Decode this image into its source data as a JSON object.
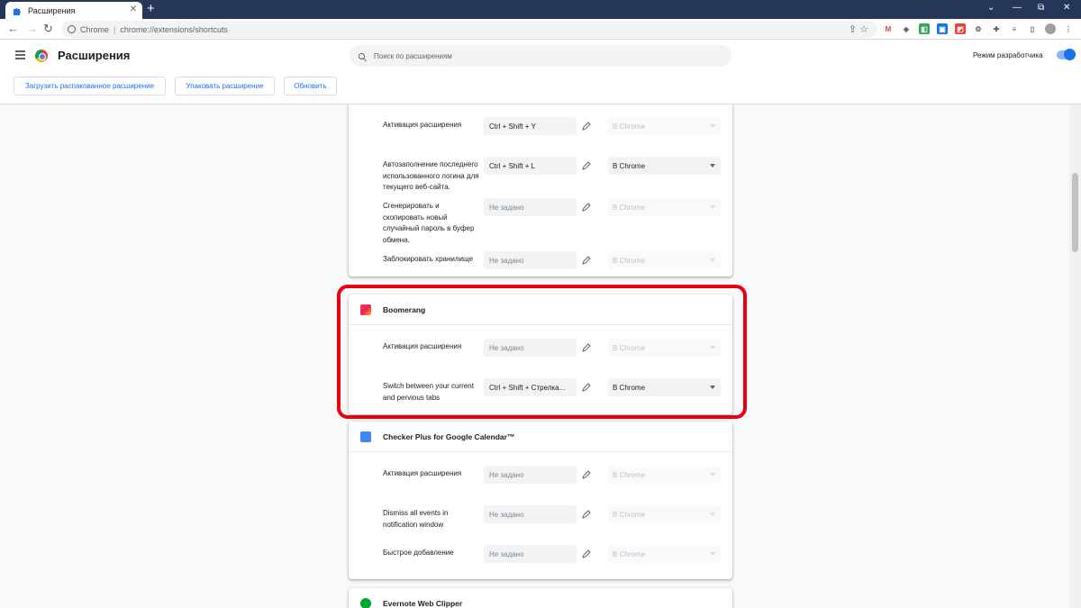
{
  "browser": {
    "tab_title": "Расширения",
    "tab_close": "✕",
    "new_tab": "+",
    "controls": {
      "dropdown": "⌄",
      "minimize": "—",
      "restore": "⧉",
      "close": "✕"
    },
    "address": {
      "site_label": "Chrome",
      "url": "chrome://extensions/shortcuts"
    }
  },
  "header": {
    "title": "Расширения",
    "search_placeholder": "Поиск по расширениям",
    "dev_mode_label": "Режим разработчика",
    "buttons": {
      "load_unpacked": "Загрузить распакованное расширение",
      "pack": "Упаковать расширение",
      "update": "Обновить"
    }
  },
  "cards": {
    "first": {
      "rows": [
        {
          "label": "Активация расширения",
          "key": "Ctrl  +  Shift  +  Y",
          "scope": "В Chrome"
        },
        {
          "label": "Автозаполнение последнего использованного логина для текущего веб-сайта.",
          "key": "Ctrl  +  Shift  +  L",
          "scope": "В Chrome"
        },
        {
          "label": "Сгенерировать и скопировать новый случайный пароль в буфер обмена.",
          "key": "Не задано",
          "scope": "В Chrome"
        },
        {
          "label": "Заблокировать хранилище",
          "key": "Не задано",
          "scope": "В Chrome"
        }
      ]
    },
    "boomerang": {
      "name": "Boomerang",
      "rows": [
        {
          "label": "Активация расширения",
          "key": "Не задано",
          "scope": "В Chrome"
        },
        {
          "label": "Switch between your current and pervious tabs",
          "key": "Ctrl  +  Shift  +  Стрелка...",
          "scope": "В Chrome"
        }
      ]
    },
    "checker": {
      "name": "Checker Plus for Google Calendar™",
      "rows": [
        {
          "label": "Активация расширения",
          "key": "Не задано",
          "scope": "В Chrome"
        },
        {
          "label": "Dismiss all events in notification window",
          "key": "Не задано",
          "scope": "В Chrome"
        },
        {
          "label": "Быстрое добавление",
          "key": "Не задано",
          "scope": "В Chrome"
        }
      ]
    },
    "evernote": {
      "name": "Evernote Web Clipper"
    }
  },
  "colors": {
    "accent": "#1a73e8",
    "highlight": "#e8000e",
    "titlebar": "#263659"
  }
}
